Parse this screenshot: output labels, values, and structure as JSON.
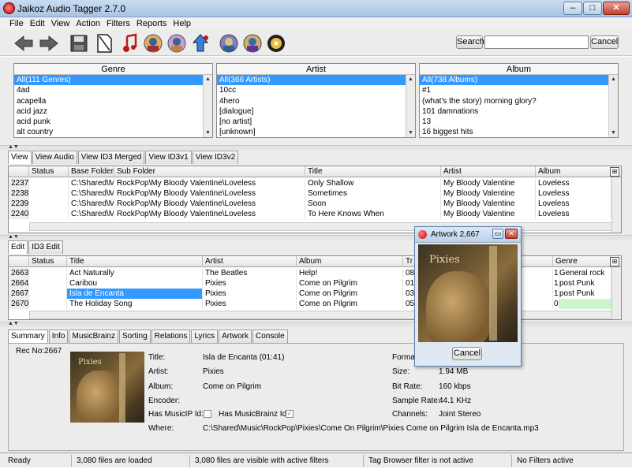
{
  "window": {
    "title": "Jaikoz Audio Tagger 2.7.0",
    "min": "–",
    "max": "□",
    "close": "✕"
  },
  "menu": [
    "File",
    "Edit",
    "View",
    "Action",
    "Filters",
    "Reports",
    "Help"
  ],
  "toolbar": {
    "icons": [
      "back-arrow-icon",
      "forward-arrow-icon",
      "save-icon",
      "document-icon",
      "music-note-icon",
      "album-art-icon",
      "album-art-2-icon",
      "upload-icon",
      "musicbrainz-icon",
      "musicbrainz-2-icon",
      "cd-icon"
    ],
    "search_label": "Search",
    "search_value": "",
    "cancel_label": "Cancel"
  },
  "browser": {
    "genre": {
      "header": "Genre",
      "items": [
        "All(111 Genres)",
        "4ad",
        "acapella",
        "acid jazz",
        "acid punk",
        "alt country"
      ]
    },
    "artist": {
      "header": "Artist",
      "items": [
        "All(366 Artists)",
        "10cc",
        "4hero",
        "[dialogue]",
        "[no artist]",
        "[unknown]"
      ]
    },
    "album": {
      "header": "Album",
      "items": [
        "All(738 Albums)",
        "#1",
        "(what's the story) morning glory?",
        "101 damnations",
        "13",
        "16 biggest hits"
      ]
    }
  },
  "view_tabs": [
    "View",
    "View Audio",
    "View ID3 Merged",
    "View ID3v1",
    "View ID3v2"
  ],
  "view_table": {
    "columns": [
      "",
      "Status",
      "Base Folder",
      "Sub Folder",
      "Title",
      "Artist",
      "Album"
    ],
    "rows": [
      [
        "2237",
        "",
        "C:\\Shared\\Mu",
        "RockPop\\My Bloody Valentine\\Loveless",
        "Only Shallow",
        "My Bloody Valentine",
        "Loveless"
      ],
      [
        "2238",
        "",
        "C:\\Shared\\Mu",
        "RockPop\\My Bloody Valentine\\Loveless",
        "Sometimes",
        "My Bloody Valentine",
        "Loveless"
      ],
      [
        "2239",
        "",
        "C:\\Shared\\Mu",
        "RockPop\\My Bloody Valentine\\Loveless",
        "Soon",
        "My Bloody Valentine",
        "Loveless"
      ],
      [
        "2240",
        "",
        "C:\\Shared\\Mu",
        "RockPop\\My Bloody Valentine\\Loveless",
        "To Here Knows When",
        "My Bloody Valentine",
        "Loveless"
      ]
    ]
  },
  "edit_tabs": [
    "Edit",
    "ID3 Edit"
  ],
  "edit_table": {
    "columns": [
      "",
      "Status",
      "Title",
      "Artist",
      "Album",
      "Tr",
      "Genre"
    ],
    "rows": [
      [
        "2663",
        "",
        "Act Naturally",
        "The Beatles",
        "Help!",
        "08",
        "1",
        "General rock"
      ],
      [
        "2664",
        "",
        "Caribou",
        "Pixies",
        "Come on Pilgrim",
        "01",
        "1",
        "post Punk"
      ],
      [
        "2667",
        "",
        "Isla de Encanta",
        "Pixies",
        "Come on Pilgrim",
        "03",
        "1",
        "post Punk"
      ],
      [
        "2670",
        "",
        "The Holiday Song",
        "Pixies",
        "Come on Pilgrim",
        "05",
        "0",
        ""
      ]
    ]
  },
  "info_tabs": [
    "Summary",
    "Info",
    "MusicBrainz",
    "Sorting",
    "Relations",
    "Lyrics",
    "Artwork",
    "Console"
  ],
  "summary": {
    "rec_no": "Rec No:2667",
    "cover_text": "Pixies",
    "title_label": "Title:",
    "title_value": "Isla de Encanta (01:41)",
    "artist_label": "Artist:",
    "artist_value": "Pixies",
    "album_label": "Album:",
    "album_value": "Come on Pilgrim",
    "encoder_label": "Encoder:",
    "encoder_value": "",
    "musicip_label": "Has MusicIP Id:",
    "musicbrainz_label": "Has MusicBrainz Id:",
    "where_label": "Where:",
    "where_value": "C:\\Shared\\Music\\RockPop\\Pixies\\Come On Pilgrim\\Pixies Come on Pilgrim Isla de Encanta.mp3",
    "format_label": "Forma",
    "size_label": "Size:",
    "size_value": "1.94 MB",
    "bitrate_label": "Bit Rate:",
    "bitrate_value": "160 kbps",
    "samplerate_label": "Sample Rate:",
    "samplerate_value": "44.1 KHz",
    "channels_label": "Channels:",
    "channels_value": "Joint Stereo"
  },
  "artwork_dialog": {
    "title": "Artwork  2,667",
    "cancel_label": "Cancel"
  },
  "status": [
    "Ready",
    "3,080 files are loaded",
    "3,080 files are visible with active filters",
    "Tag Browser filter is not active",
    "No Filters active"
  ]
}
